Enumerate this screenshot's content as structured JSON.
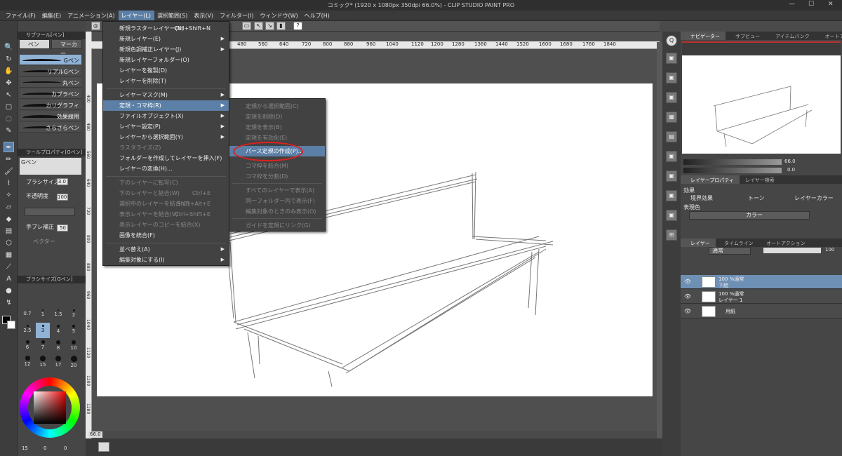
{
  "window": {
    "title": "コミック* (1920 x 1080px 350dpi 66.0%) - CLIP STUDIO PAINT PRO",
    "minimize": "—",
    "maximize": "☐",
    "close": "✕"
  },
  "menubar": [
    "ファイル(F)",
    "編集(E)",
    "アニメーション(A)",
    "レイヤー(L)",
    "選択範囲(S)",
    "表示(V)",
    "フィルター(I)",
    "ウィンドウ(W)",
    "ヘルプ(H)"
  ],
  "active_menu": "レイヤー(L)",
  "layer_menu": {
    "items": [
      {
        "label": "新規ラスターレイヤー(N)",
        "shortcut": "Ctrl+Shift+N"
      },
      {
        "label": "新規レイヤー(E)",
        "arrow": "▶"
      },
      {
        "label": "新規色調補正レイヤー(J)",
        "arrow": "▶"
      },
      {
        "label": "新規レイヤーフォルダー(O)"
      },
      {
        "label": "レイヤーを複製(D)"
      },
      {
        "label": "レイヤーを削除(T)"
      },
      {
        "label": "レイヤーマスク(M)",
        "arrow": "▶"
      },
      {
        "label": "定規・コマ枠(R)",
        "arrow": "▶"
      },
      {
        "label": "ファイルオブジェクト(X)",
        "arrow": "▶"
      },
      {
        "label": "レイヤー設定(P)",
        "arrow": "▶"
      },
      {
        "label": "レイヤーから選択範囲(Y)",
        "arrow": "▶"
      },
      {
        "label": "ラスタライズ(Z)"
      },
      {
        "label": "フォルダーを作成してレイヤーを挿入(F)"
      },
      {
        "label": "レイヤーの変換(H)..."
      },
      {
        "label": "下のレイヤーに転写(C)"
      },
      {
        "label": "下のレイヤーと結合(W)",
        "shortcut": "Ctrl+E"
      },
      {
        "label": "選択中のレイヤーを結合(G)",
        "shortcut": "Shift+Alt+E"
      },
      {
        "label": "表示レイヤーを結合(V)",
        "shortcut": "Ctrl+Shift+E"
      },
      {
        "label": "表示レイヤーのコピーを結合(X)"
      },
      {
        "label": "画像を統合(F)"
      },
      {
        "label": "並べ替え(A)",
        "arrow": "▶"
      },
      {
        "label": "編集対象にする(I)",
        "arrow": "▶"
      }
    ]
  },
  "ruler_submenu": {
    "items": [
      {
        "label": "定規から選択範囲(C)"
      },
      {
        "label": "定規を削除(D)"
      },
      {
        "label": "定規を表示(B)"
      },
      {
        "label": "定規を有効化(E)"
      },
      {
        "label": "パース定規の作成(P)..."
      },
      {
        "label": "コマ枠を結合(M)"
      },
      {
        "label": "コマ枠を分割(D)"
      },
      {
        "label": "すべてのレイヤーで表示(A)"
      },
      {
        "label": "同一フォルダー内で表示(F)"
      },
      {
        "label": "編集対象のときのみ表示(O)"
      },
      {
        "label": "ガイドを定規にリンク(G)"
      }
    ]
  },
  "toolbar": {
    "help_label": "?"
  },
  "ruler_ticks": [
    "480",
    "560",
    "640",
    "720",
    "800",
    "880",
    "960",
    "1040",
    "1120",
    "1200",
    "1280",
    "1360",
    "1440",
    "1520",
    "1600",
    "1680",
    "1760",
    "1840"
  ],
  "ruler_left_ticks": [
    "400",
    "480",
    "560",
    "640",
    "720",
    "800",
    "880",
    "960",
    "1040",
    "1120",
    "1200",
    "1280"
  ],
  "subtool_panel": {
    "title": "サブツール[ペン]",
    "tabs": [
      "ペン",
      "マーカー"
    ],
    "brushes": [
      "Gペン",
      "リアルGペン",
      "丸ペン",
      "カブラペン",
      "カリグラフィ",
      "効果線用",
      "さらさらペン"
    ]
  },
  "tool_property": {
    "title": "ツールプロパティ[Gペン]",
    "brush_name": "Gペン",
    "brush_size_label": "ブラシサイズ",
    "brush_size_value": "3.0",
    "opacity_label": "不透明度",
    "opacity_value": "100",
    "stabilize_label": "手ブレ補正",
    "stabilize_value": "50",
    "vector_label": "ベクター"
  },
  "brush_size_panel": {
    "title": "ブラシサイズ[Gペン]",
    "sizes": [
      "0.7",
      "1",
      "1.5",
      "2",
      "2.5",
      "3",
      "4",
      "5",
      "6",
      "7",
      "8",
      "10",
      "12",
      "15",
      "17",
      "20"
    ],
    "selected": "3"
  },
  "navigator_tabs": [
    "ナビゲーター",
    "サブビュー",
    "アイテムバンク",
    "オートアクション"
  ],
  "navigator": {
    "zoom": "66.0",
    "angle": "0.0"
  },
  "layer_property": {
    "tabs": [
      "レイヤープロパティ",
      "レイヤー検索"
    ],
    "effect_label": "効果",
    "effects": [
      "境界効果",
      "トーン",
      "レイヤーカラー"
    ],
    "color_label": "表現色",
    "color_value": "カラー"
  },
  "layer_panel": {
    "tabs": [
      "レイヤー",
      "タイムライン",
      "オートアクション"
    ],
    "blend_mode": "通常",
    "opacity": "100",
    "layers": [
      {
        "line1": "100 %通常",
        "line2": "下絵",
        "selected": true
      },
      {
        "line1": "100 %通常",
        "line2": "レイヤー 1",
        "selected": false
      },
      {
        "line1": "",
        "line2": "用紙",
        "selected": false
      }
    ]
  },
  "status": {
    "zoom": "66.0"
  },
  "color_slots": [
    "15",
    "0",
    "0"
  ]
}
